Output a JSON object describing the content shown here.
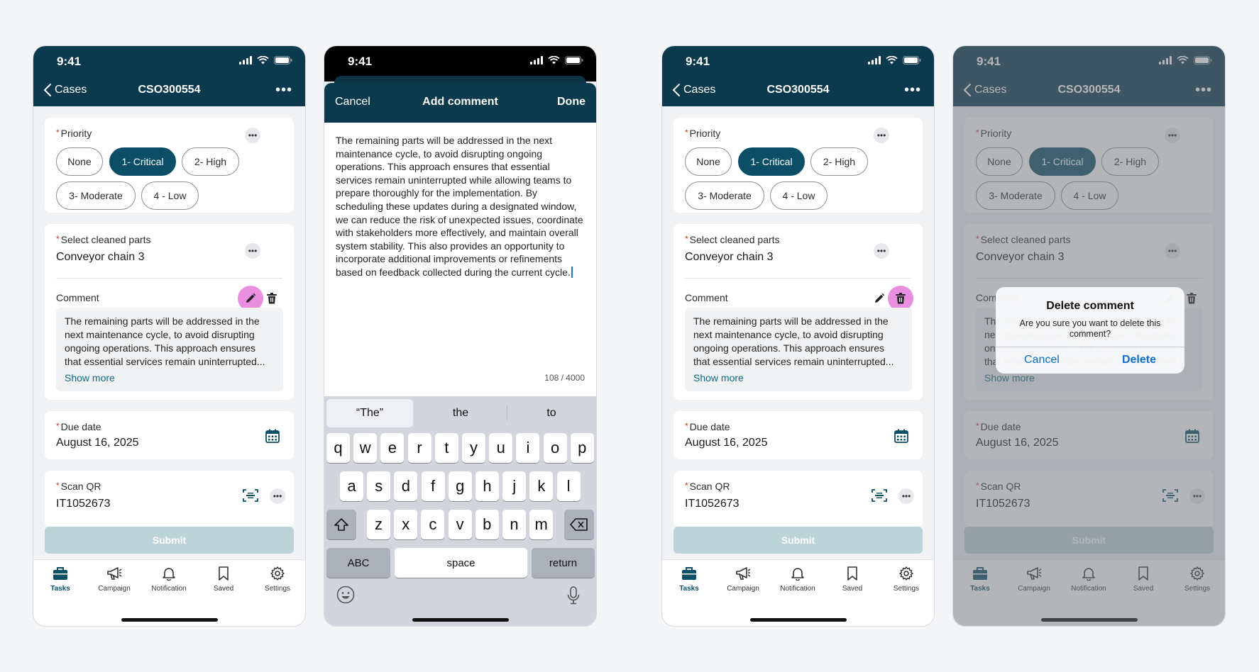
{
  "status": {
    "time": "9:41"
  },
  "header": {
    "back_label": "Cases",
    "title": "CSO300554",
    "more": "•••"
  },
  "form": {
    "priority_label": "Priority",
    "priority_options": [
      "None",
      "1- Critical",
      "2- High",
      "3- Moderate",
      "4 - Low"
    ],
    "priority_selected": "1- Critical",
    "parts_label": "Select cleaned parts",
    "parts_value": "Conveyor chain 3",
    "comment_label": "Comment",
    "comment_preview": "The remaining parts will be addressed in the next maintenance cycle, to avoid disrupting ongoing operations. This approach ensures that essential services remain uninterrupted...",
    "show_more": "Show more",
    "due_label": "Due date",
    "due_value": "August 16, 2025",
    "qr_label": "Scan QR",
    "qr_value": "IT1052673",
    "submit_label": "Submit",
    "required_mark": "*"
  },
  "tabs": [
    "Tasks",
    "Campaign",
    "Notification",
    "Saved",
    "Settings"
  ],
  "add_comment": {
    "cancel": "Cancel",
    "title": "Add comment",
    "done": "Done",
    "text": "The remaining parts will be addressed in the next maintenance cycle, to avoid disrupting ongoing operations. This approach ensures that essential services remain uninterrupted while allowing teams to prepare thoroughly for the implementation. By scheduling these updates during a designated window, we can reduce the risk of unexpected issues, coordinate with stakeholders more effectively, and maintain overall system stability. This also provides an opportunity to incorporate additional improvements or refinements based on feedback collected during the current cycle.",
    "counter": "108 / 4000"
  },
  "keyboard": {
    "suggestions": [
      "“The”",
      "the",
      "to"
    ],
    "row1": [
      "q",
      "w",
      "e",
      "r",
      "t",
      "y",
      "u",
      "i",
      "o",
      "p"
    ],
    "row2": [
      "a",
      "s",
      "d",
      "f",
      "g",
      "h",
      "j",
      "k",
      "l"
    ],
    "row3": [
      "z",
      "x",
      "c",
      "v",
      "b",
      "n",
      "m"
    ],
    "abc": "ABC",
    "space": "space",
    "return": "return"
  },
  "delete_dialog": {
    "title": "Delete comment",
    "message": "Are you sure you want to delete this comment?",
    "cancel": "Cancel",
    "delete": "Delete"
  },
  "colors": {
    "header": "#0b3a4f",
    "accent": "#0b4f66",
    "highlight": "#ea8fe0",
    "link": "#0a6a86"
  }
}
